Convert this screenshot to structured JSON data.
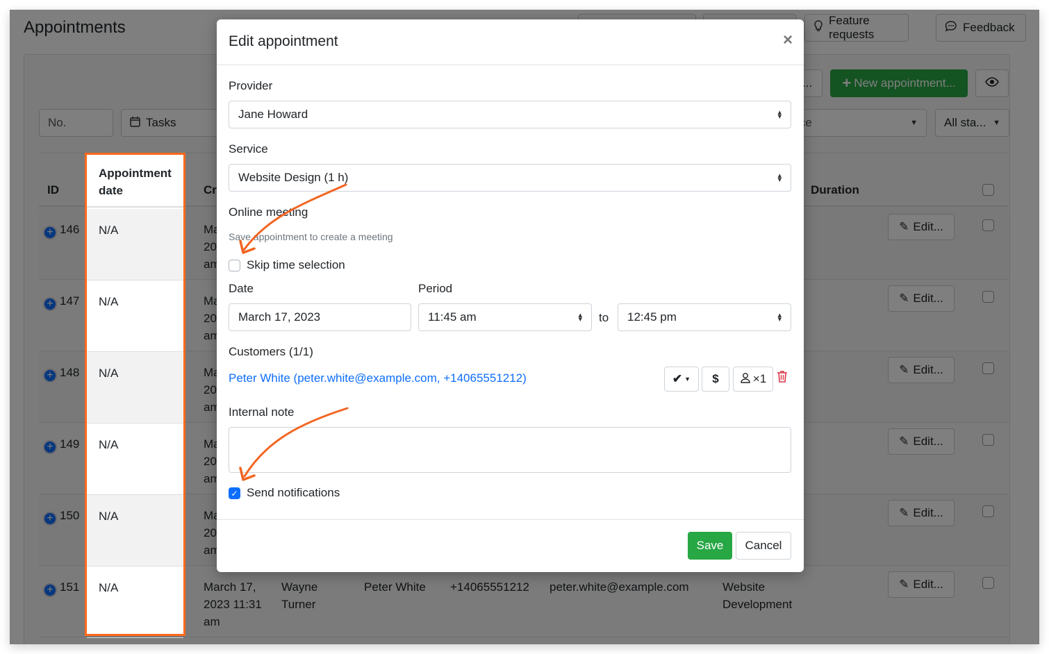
{
  "page": {
    "title": "Appointments",
    "top_buttons": {
      "feature_requests": "Feature requests",
      "feedback": "Feedback"
    },
    "toolbar": {
      "partial_label": "...",
      "new_appointment": "New appointment...",
      "view_icon": "eye-icon"
    },
    "filters": {
      "number_placeholder": "No.",
      "tasks": "Tasks",
      "service": "ice",
      "status": "All sta..."
    },
    "table": {
      "headers": {
        "id": "ID",
        "appointment_date_line1": "Appointment",
        "appointment_date_line2": "date",
        "created": "Cr",
        "duration": "Duration"
      },
      "rows": [
        {
          "id": "146",
          "appointment_date": "N/A",
          "created_partial": [
            "Ma",
            "20",
            "am"
          ],
          "edit": "Edit..."
        },
        {
          "id": "147",
          "appointment_date": "N/A",
          "created_partial": [
            "Ma",
            "20",
            "am"
          ],
          "edit": "Edit..."
        },
        {
          "id": "148",
          "appointment_date": "N/A",
          "created_partial": [
            "Ma",
            "20",
            "am"
          ],
          "edit": "Edit..."
        },
        {
          "id": "149",
          "appointment_date": "N/A",
          "created_partial": [
            "Ma",
            "20",
            "am"
          ],
          "edit": "Edit..."
        },
        {
          "id": "150",
          "appointment_date": "N/A",
          "created_partial": [
            "Ma",
            "20",
            "am"
          ],
          "edit": "Edit..."
        },
        {
          "id": "151",
          "appointment_date": "N/A",
          "created": [
            "March 17,",
            "2023 11:31",
            "am"
          ],
          "provider": [
            "Wayne",
            "Turner"
          ],
          "customer": "Peter White",
          "phone": "+14065551212",
          "email": "peter.white@example.com",
          "service": [
            "Website",
            "Development"
          ],
          "edit": "Edit..."
        }
      ]
    }
  },
  "modal": {
    "title": "Edit appointment",
    "close_icon": "close-icon",
    "provider": {
      "label": "Provider",
      "value": "Jane Howard"
    },
    "service": {
      "label": "Service",
      "value": "Website Design (1 h)"
    },
    "online_meeting": {
      "label": "Online meeting",
      "hint": "Save appointment to create a meeting"
    },
    "skip_time": {
      "label": "Skip time selection",
      "checked": false
    },
    "date": {
      "label": "Date",
      "value": "March 17, 2023"
    },
    "period": {
      "label": "Period",
      "from": "11:45 am",
      "separator": "to",
      "to": "12:45 pm"
    },
    "customers": {
      "label": "Customers (1/1)",
      "entry": "Peter White (peter.white@example.com, +14065551212)",
      "status_icon": "check-icon",
      "payment_icon": "dollar-icon",
      "count_label": "×1"
    },
    "internal_note": {
      "label": "Internal note",
      "value": ""
    },
    "send_notifications": {
      "label": "Send notifications",
      "checked": true
    },
    "save": "Save",
    "cancel": "Cancel"
  },
  "colors": {
    "accent": "#0d6efd",
    "success": "#28a745",
    "highlight": "#ff6a1a",
    "danger": "#dc3545"
  }
}
